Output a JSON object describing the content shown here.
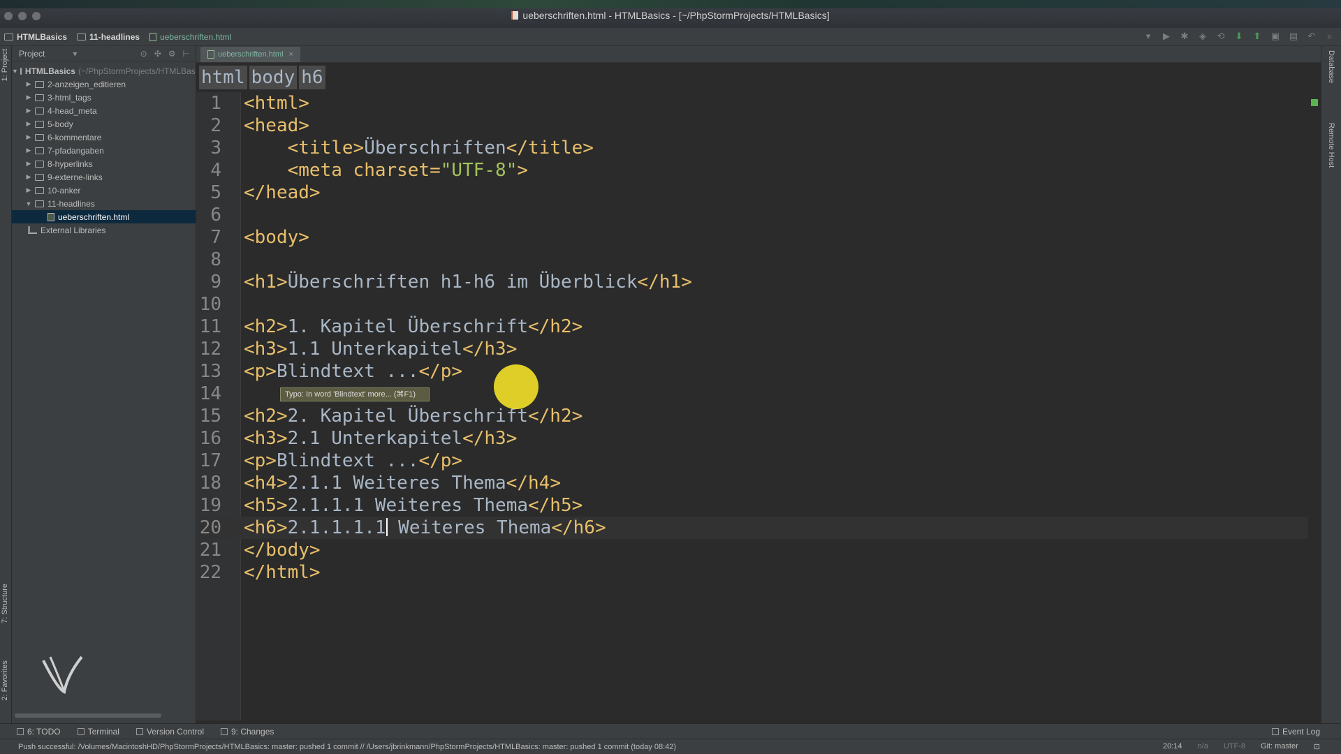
{
  "window": {
    "title": "ueberschriften.html - HTMLBasics - [~/PhpStormProjects/HTMLBasics]"
  },
  "navbar": {
    "project": "HTMLBasics",
    "folder": "11-headlines",
    "file": "ueberschriften.html"
  },
  "project_panel": {
    "header": "Project",
    "root": {
      "label": "HTMLBasics",
      "path": "(~/PhpStormProjects/HTMLBasics)"
    },
    "folders": [
      "2-anzeigen_editieren",
      "3-html_tags",
      "4-head_meta",
      "5-body",
      "6-kommentare",
      "7-pfadangaben",
      "8-hyperlinks",
      "9-externe-links",
      "10-anker",
      "11-headlines"
    ],
    "selected_file": "ueberschriften.html",
    "libraries": "External Libraries"
  },
  "left_labels": {
    "project": "1: Project",
    "structure": "7: Structure",
    "favorites": "2: Favorites"
  },
  "right_labels": {
    "database": "Database",
    "remote": "Remote Host"
  },
  "editor": {
    "tab": "ueberschriften.html",
    "breadcrumbs": [
      "html",
      "body",
      "h6"
    ],
    "lines": [
      "<html>",
      "<head>",
      "    <title>Überschriften</title>",
      "    <meta charset=\"UTF-8\">",
      "</head>",
      "",
      "<body>",
      "",
      "<h1>Überschriften h1-h6 im Überblick</h1>",
      "",
      "<h2>1. Kapitel Überschrift</h2>",
      "<h3>1.1 Unterkapitel</h3>",
      "<p>Blindtext ...</p>",
      "",
      "<h2>2. Kapitel Überschrift</h2>",
      "<h3>2.1 Unterkapitel</h3>",
      "<p>Blindtext ...</p>",
      "<h4>2.1.1 Weiteres Thema</h4>",
      "<h5>2.1.1.1 Weiteres Thema</h5>",
      "<h6>2.1.1.1.1 Weiteres Thema</h6>",
      "</body>",
      "</html>"
    ],
    "current_line": 20,
    "tooltip": "Typo: In word 'Blindtext' more... (⌘F1)"
  },
  "toolwindows": {
    "todo": "6: TODO",
    "terminal": "Terminal",
    "vcs": "Version Control",
    "changes": "9: Changes",
    "event_log": "Event Log"
  },
  "status": {
    "message": "Push successful: /Volumes/MacintoshHD/PhpStormProjects/HTMLBasics: master: pushed 1 commit // /Users/jbrinkmann/PhpStormProjects/HTMLBasics: master: pushed 1 commit (today 08:42)",
    "position": "20:14",
    "na": "n/a",
    "encoding": "UTF-8",
    "git": "Git: master"
  }
}
